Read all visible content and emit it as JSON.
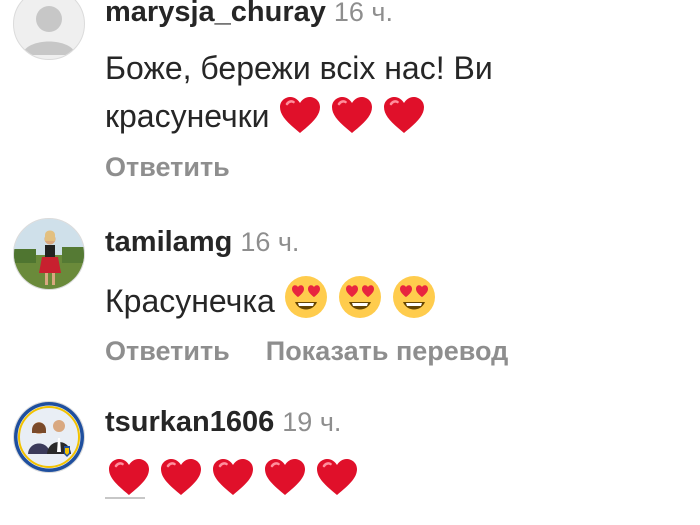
{
  "comments": [
    {
      "username": "marysja_churay",
      "time": "16 ч.",
      "text_line1": "Боже, бережи всіх нас! Ви",
      "text_line2": "красунечки",
      "emojis": [
        "heart",
        "heart",
        "heart"
      ],
      "reply_label": "Ответить",
      "avatar": "default-avatar-icon"
    },
    {
      "username": "tamilamg",
      "time": "16 ч.",
      "text": "Красунечка",
      "emojis": [
        "heart-eyes",
        "heart-eyes",
        "heart-eyes"
      ],
      "reply_label": "Ответить",
      "translate_label": "Показать перевод",
      "avatar": "photo-avatar"
    },
    {
      "username": "tsurkan1606",
      "time": "19 ч.",
      "emojis": [
        "heart",
        "heart",
        "heart",
        "heart",
        "heart"
      ],
      "avatar": "photo-avatar"
    }
  ],
  "colors": {
    "text": "#262626",
    "secondary": "#8e8e8e",
    "heart": "#e0102a"
  }
}
